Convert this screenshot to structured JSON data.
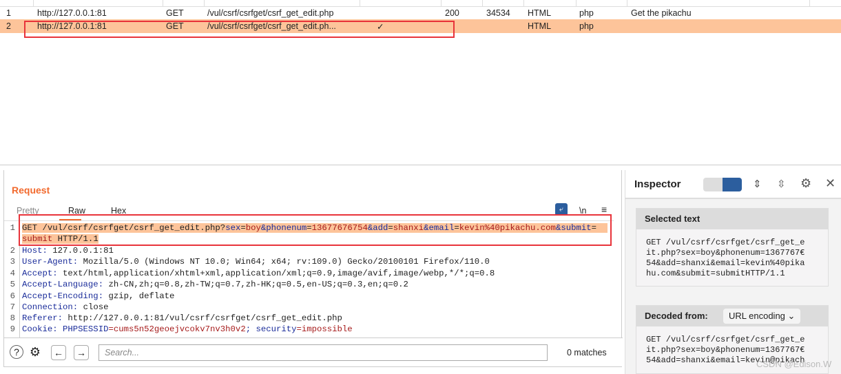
{
  "history": {
    "rows": [
      {
        "num": "1",
        "host": "http://127.0.0.1:81",
        "method": "GET",
        "url": "/vul/csrf/csrfget/csrf_get_edit.php",
        "params": "",
        "status": "200",
        "length": "34534",
        "mime": "HTML",
        "ext": "php",
        "title": "Get the pikachu"
      },
      {
        "num": "2",
        "host": "http://127.0.0.1:81",
        "method": "GET",
        "url": "/vul/csrf/csrfget/csrf_get_edit.ph...",
        "params": "✓",
        "status": "",
        "length": "",
        "mime": "HTML",
        "ext": "php",
        "title": ""
      }
    ],
    "selected_row": 2
  },
  "request": {
    "title": "Request",
    "tabs": [
      "Pretty",
      "Raw",
      "Hex"
    ],
    "active_tab": "Raw",
    "wrap_icon": "wrap-icon",
    "newline_label": "\\n",
    "menu_icon": "menu-icon",
    "line1a": {
      "method": "GET /vul/csrf/csrfget/csrf_get_edit.php?",
      "k1": "sex",
      "v1": "boy",
      "k2": "&phonenum",
      "v2": "13677676754",
      "k3": "&add",
      "v3": "shanxi",
      "k4": "&email",
      "v4": "kevin%40pikachu.com",
      "k5": "&submit",
      "eq": "="
    },
    "line1b": {
      "v5": "submit",
      "rest": " HTTP/1.1"
    },
    "lines": [
      {
        "n": "2",
        "k": "Host:",
        "v": " 127.0.0.1:81"
      },
      {
        "n": "3",
        "k": "User-Agent:",
        "v": " Mozilla/5.0 (Windows NT 10.0; Win64; x64; rv:109.0) Gecko/20100101 Firefox/110.0"
      },
      {
        "n": "4",
        "k": "Accept:",
        "v": " text/html,application/xhtml+xml,application/xml;q=0.9,image/avif,image/webp,*/*;q=0.8"
      },
      {
        "n": "5",
        "k": "Accept-Language:",
        "v": " zh-CN,zh;q=0.8,zh-TW;q=0.7,zh-HK;q=0.5,en-US;q=0.3,en;q=0.2"
      },
      {
        "n": "6",
        "k": "Accept-Encoding:",
        "v": " gzip, deflate"
      },
      {
        "n": "7",
        "k": "Connection:",
        "v": " close"
      },
      {
        "n": "8",
        "k": "Referer:",
        "v": " http://127.0.0.1:81/vul/csrf/csrfget/csrf_get_edit.php"
      }
    ],
    "cookie": {
      "n": "9",
      "k": "Cookie:",
      "k1": " PHPSESSID",
      "v1": "=cums5n52geoejvcokv7nv3h0v2",
      "k2": "; security",
      "v2": "=impossible"
    },
    "search_placeholder": "Search...",
    "matches": "0 matches"
  },
  "inspector": {
    "title": "Inspector",
    "selected_text": {
      "label": "Selected text",
      "value": "GET /vul/csrf/csrfget/csrf_get_e\nit.php?sex=boy&phonenum=1367767€\n54&add=shanxi&email=kevin%40pika\nhu.com&submit=submitHTTP/1.1"
    },
    "decoded": {
      "label": "Decoded from:",
      "encoding": "URL encoding",
      "value": "GET /vul/csrf/csrfget/csrf_get_e\nit.php?sex=boy&phonenum=1367767€\n54&add=shanxi&email=kevin@pikach"
    }
  },
  "watermark": "CSDN @Edison.W",
  "colors": {
    "accent": "#f26a2e",
    "selection": "#fdc49a",
    "highlight_box": "#e8333a",
    "key": "#1a2c9a",
    "value": "#a61b1b"
  }
}
